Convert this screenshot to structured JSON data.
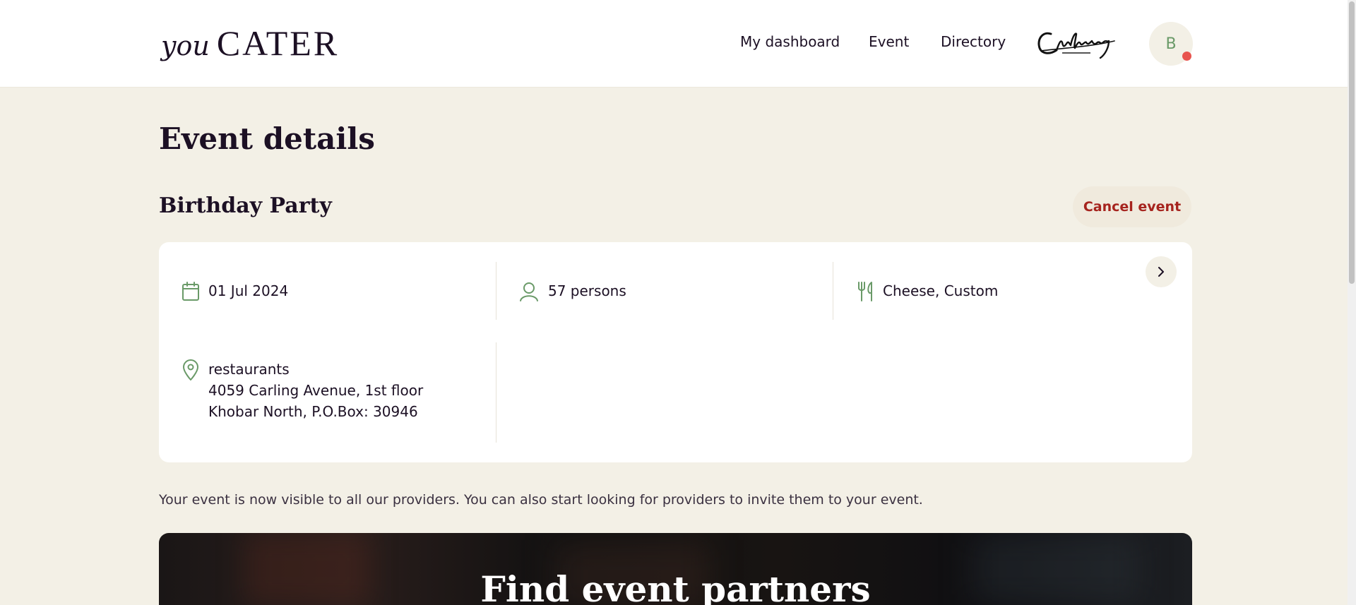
{
  "header": {
    "logo_you": "you",
    "logo_cater": "CATER",
    "nav": [
      "My dashboard",
      "Event",
      "Directory"
    ],
    "avatar_initial": "B"
  },
  "page": {
    "title": "Event details",
    "event_name": "Birthday Party",
    "cancel_label": "Cancel event"
  },
  "details": {
    "date": "01 Jul 2024",
    "guests": "57 persons",
    "cuisine": "Cheese, Custom",
    "venue_name": "restaurants",
    "address_line1": "4059 Carling Avenue, 1st floor",
    "address_line2": "Khobar North, P.O.Box: 30946"
  },
  "info_text": "Your event is now visible to all our providers. You can also start looking for providers to invite them to your event.",
  "banner": {
    "title": "Find event partners"
  },
  "colors": {
    "background": "#f3f0e6",
    "icon_green": "#6a9a68",
    "cancel_red": "#a6241e",
    "notification_dot": "#e8544e"
  }
}
